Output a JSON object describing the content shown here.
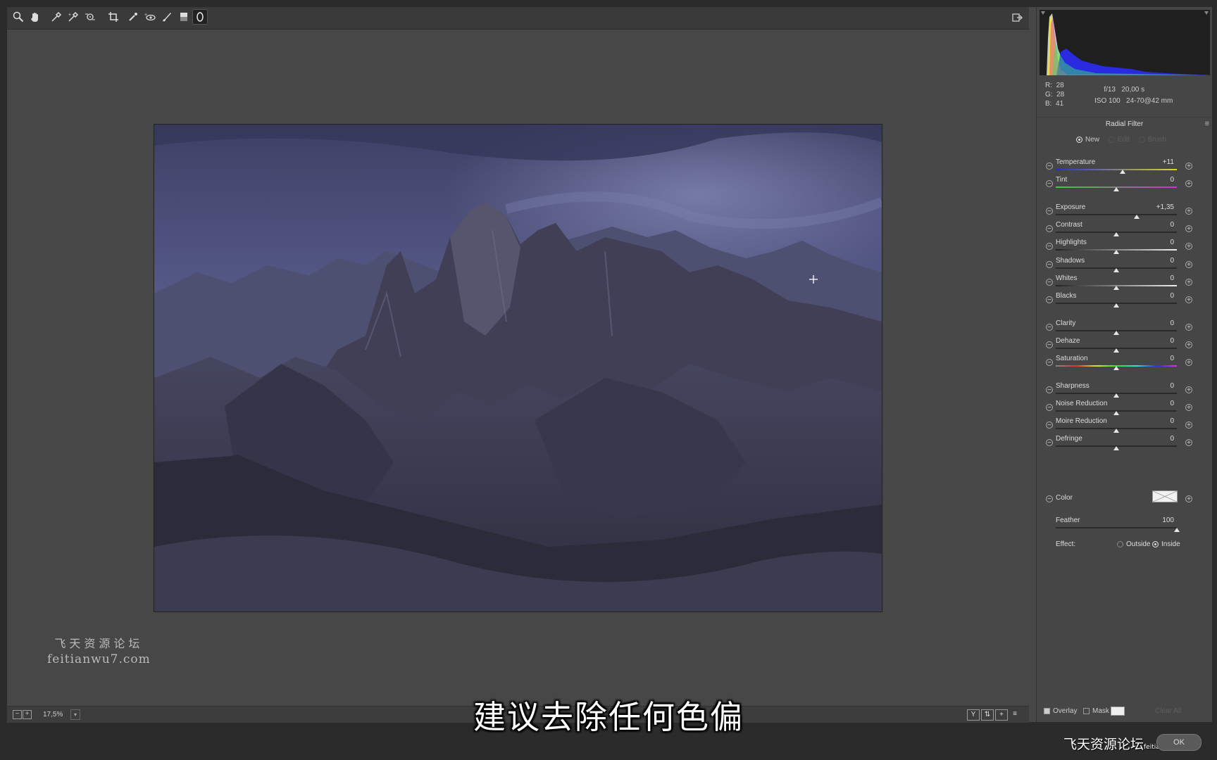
{
  "toolbar": {
    "tools": [
      "zoom-tool",
      "hand-tool",
      "white-balance-tool",
      "color-sampler-tool",
      "targeted-adjustment-tool",
      "crop-tool",
      "spot-removal-tool",
      "red-eye-tool",
      "adjustment-brush-tool",
      "graduated-filter-tool",
      "radial-filter-tool"
    ],
    "active_tool": "radial-filter-tool"
  },
  "watermark": {
    "line1": "飞天资源论坛",
    "line2": "feitianwu7.com"
  },
  "statusbar": {
    "zoom_out": "−",
    "zoom_in": "+",
    "zoom": "17,5%",
    "view_y": "Y",
    "dropdown": "▾"
  },
  "subtitle": "建议去除任何色偏",
  "info": {
    "r_label": "R:",
    "r": "28",
    "g_label": "G:",
    "g": "28",
    "b_label": "B:",
    "b": "41",
    "aperture": "f/13",
    "shutter": "20,00 s",
    "iso": "ISO 100",
    "lens": "24-70@42 mm"
  },
  "panel": {
    "title": "Radial Filter",
    "menu_icon": "≡",
    "mode_new": "New",
    "mode_edit": "Edit",
    "mode_brush": "Brush",
    "sliders": [
      {
        "label": "Temperature",
        "value": "+11",
        "pos": 0.55,
        "track": "temp"
      },
      {
        "label": "Tint",
        "value": "0",
        "pos": 0.5,
        "track": "tint"
      },
      {
        "label": "Exposure",
        "value": "+1,35",
        "pos": 0.67,
        "track": "plain"
      },
      {
        "label": "Contrast",
        "value": "0",
        "pos": 0.5,
        "track": "plain"
      },
      {
        "label": "Highlights",
        "value": "0",
        "pos": 0.5,
        "track": "light"
      },
      {
        "label": "Shadows",
        "value": "0",
        "pos": 0.5,
        "track": "plain"
      },
      {
        "label": "Whites",
        "value": "0",
        "pos": 0.5,
        "track": "light"
      },
      {
        "label": "Blacks",
        "value": "0",
        "pos": 0.5,
        "track": "plain"
      },
      {
        "label": "Clarity",
        "value": "0",
        "pos": 0.5,
        "track": "plain"
      },
      {
        "label": "Dehaze",
        "value": "0",
        "pos": 0.5,
        "track": "plain"
      },
      {
        "label": "Saturation",
        "value": "0",
        "pos": 0.5,
        "track": "sat"
      },
      {
        "label": "Sharpness",
        "value": "0",
        "pos": 0.5,
        "track": "plain"
      },
      {
        "label": "Noise Reduction",
        "value": "0",
        "pos": 0.5,
        "track": "plain"
      },
      {
        "label": "Moire Reduction",
        "value": "0",
        "pos": 0.5,
        "track": "plain"
      },
      {
        "label": "Defringe",
        "value": "0",
        "pos": 0.5,
        "track": "plain"
      }
    ],
    "color_label": "Color",
    "feather_label": "Feather",
    "feather_value": "100",
    "feather_pos": 1.0,
    "effect_label": "Effect:",
    "effect_outside": "Outside",
    "effect_inside": "Inside",
    "effect_selected": "Inside",
    "overlay_label": "Overlay",
    "overlay_checked": true,
    "mask_label": "Mask",
    "mask_checked": false,
    "clear_all": "Clear All"
  },
  "footer": {
    "logo": "飞天资源论坛",
    "logo_small": "feitianwu7.com",
    "ok_label": "OK"
  }
}
